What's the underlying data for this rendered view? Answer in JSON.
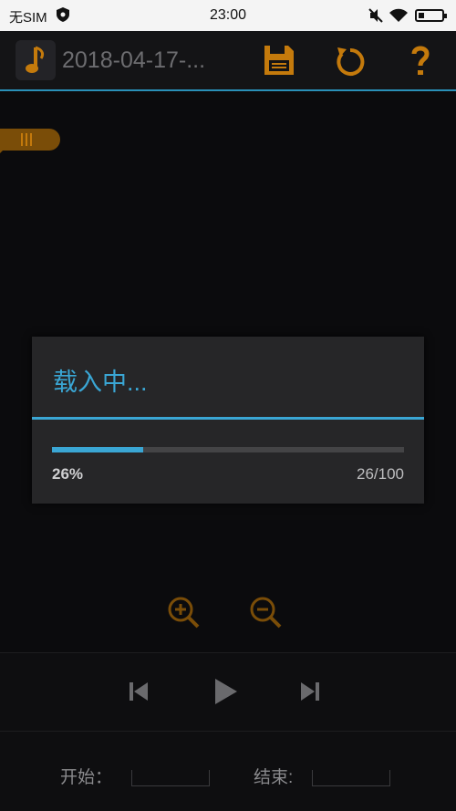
{
  "status_bar": {
    "carrier": "无SIM",
    "time": "23:00"
  },
  "app_bar": {
    "title": "2018-04-17-...",
    "icons": [
      "music-note-icon",
      "save-icon",
      "undo-icon",
      "help-icon"
    ],
    "accent_color": "#c47a0c"
  },
  "dialog": {
    "title": "载入中...",
    "progress_percent": "26%",
    "progress_count": "26/100",
    "progress_value": 0.26,
    "accent_color": "#3aa6d4"
  },
  "zoom": {
    "icons": [
      "zoom-in-icon",
      "zoom-out-icon"
    ]
  },
  "player": {
    "icons": [
      "skip-previous-icon",
      "play-icon",
      "skip-next-icon"
    ]
  },
  "range": {
    "start_label": "开始：",
    "start_value": "",
    "end_label": "结束:",
    "end_value": ""
  }
}
